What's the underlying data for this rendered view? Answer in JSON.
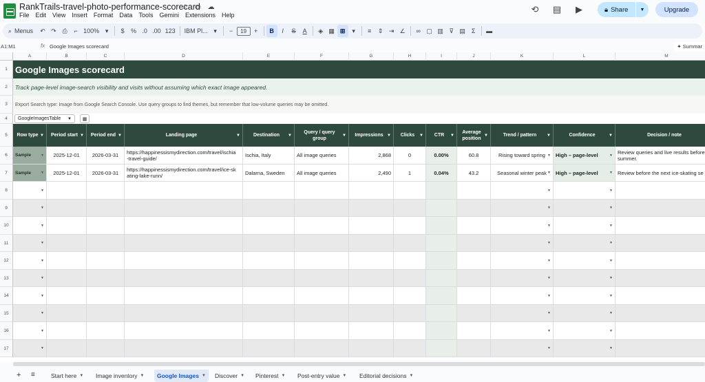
{
  "window": {
    "doc_title": "RankTrails-travel-photo-performance-scorecard",
    "menu": [
      "File",
      "Edit",
      "View",
      "Insert",
      "Format",
      "Data",
      "Tools",
      "Gemini",
      "Extensions",
      "Help"
    ],
    "share_label": "Share",
    "upgrade_label": "Upgrade"
  },
  "toolbar": {
    "menus_label": "Menus",
    "zoom": "100%",
    "currency": "$",
    "percent": "%",
    "dec_decrease": ".0",
    "dec_increase": ".00",
    "number_format": "123",
    "font": "IBM Pl...",
    "font_size": "19",
    "bold": "B",
    "italic": "I",
    "strike": "S",
    "text_color": "A",
    "sigma": "Σ"
  },
  "formula_bar": {
    "name_box": "A1:M1",
    "fx": "fx",
    "content": "Google Images scorecard",
    "summary_label": "Summar"
  },
  "columns": [
    "A",
    "B",
    "C",
    "D",
    "E",
    "F",
    "G",
    "H",
    "I",
    "J",
    "K",
    "L",
    "M"
  ],
  "rows": [
    "1",
    "2",
    "3",
    "4",
    "5",
    "6",
    "7",
    "8",
    "9",
    "10",
    "11",
    "12",
    "13",
    "14",
    "15",
    "16",
    "17"
  ],
  "sheet": {
    "title": "Google Images scorecard",
    "subtitle": "Track page-level image-search visibility and visits without assuming which exact image appeared.",
    "note": "Export Search type: Image from Google Search Console. Use query groups to find themes, but remember that low-volume queries may be omitted.",
    "table_name": "GoogleImagesTable",
    "headers": [
      "Row type",
      "Period start",
      "Period end",
      "Landing page",
      "Destination",
      "Query / query group",
      "Impressions",
      "Clicks",
      "CTR",
      "Average position",
      "Trend / pattern",
      "Confidence",
      "Decision / note"
    ],
    "data_rows": [
      {
        "row_type": "Sample",
        "period_start": "2025-12-01",
        "period_end": "2026-03-31",
        "landing_page_1": "https://happinessismydirection.com/travel/ischia",
        "landing_page_2": "-travel-guide/",
        "destination": "Ischia, Italy",
        "query_group": "All image queries",
        "impressions": "2,868",
        "clicks": "0",
        "ctr": "0.00%",
        "avg_position": "60.8",
        "trend": "Rising toward spring",
        "confidence": "High – page-level",
        "decision_1": "Review queries and live results before",
        "decision_2": "summer."
      },
      {
        "row_type": "Sample",
        "period_start": "2025-12-01",
        "period_end": "2026-03-31",
        "landing_page_1": "https://happinessismydirection.com/travel/ice-sk",
        "landing_page_2": "ating-lake-runn/",
        "destination": "Dalarna, Sweden",
        "query_group": "All image queries",
        "impressions": "2,490",
        "clicks": "1",
        "ctr": "0.04%",
        "avg_position": "43.2",
        "trend": "Seasonal winter peak",
        "confidence": "High – page-level",
        "decision_1": "Review before the next ice-skating se",
        "decision_2": ""
      }
    ]
  },
  "sheet_tabs": [
    {
      "label": "Start here",
      "active": false
    },
    {
      "label": "Image inventory",
      "active": false
    },
    {
      "label": "Google Images",
      "active": true
    },
    {
      "label": "Discover",
      "active": false
    },
    {
      "label": "Pinterest",
      "active": false
    },
    {
      "label": "Post-entry value",
      "active": false
    },
    {
      "label": "Editorial decisions",
      "active": false
    }
  ],
  "colors": {
    "header_green": "#2e4a3e",
    "subtitle_band": "#eaf2ec",
    "accent_blue": "#0b57d0",
    "share_bg": "#c2e7ff"
  }
}
